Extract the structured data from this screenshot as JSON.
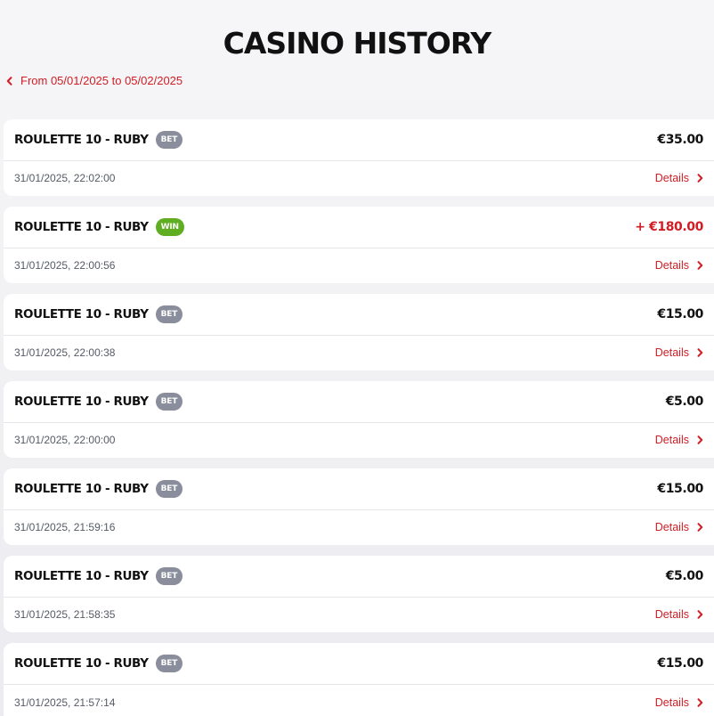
{
  "page": {
    "title": "CASINO HISTORY",
    "date_range_label": "From 05/01/2025 to 05/02/2025"
  },
  "colors": {
    "accent": "#d01e24",
    "bet_badge": "#8a8d9c",
    "win_badge": "#5fae22",
    "card_bg": "#ffffff",
    "page_bg": "#f1f1f4"
  },
  "icons": {
    "back": "chevron-left-icon",
    "details": "chevron-right-icon"
  },
  "transactions": [
    {
      "game": "ROULETTE 10 - RUBY",
      "type": "BET",
      "amount": "€35.00",
      "timestamp": "31/01/2025, 22:02:00",
      "details_label": "Details"
    },
    {
      "game": "ROULETTE 10 - RUBY",
      "type": "WIN",
      "amount": "+ €180.00",
      "timestamp": "31/01/2025, 22:00:56",
      "details_label": "Details"
    },
    {
      "game": "ROULETTE 10 - RUBY",
      "type": "BET",
      "amount": "€15.00",
      "timestamp": "31/01/2025, 22:00:38",
      "details_label": "Details"
    },
    {
      "game": "ROULETTE 10 - RUBY",
      "type": "BET",
      "amount": "€5.00",
      "timestamp": "31/01/2025, 22:00:00",
      "details_label": "Details"
    },
    {
      "game": "ROULETTE 10 - RUBY",
      "type": "BET",
      "amount": "€15.00",
      "timestamp": "31/01/2025, 21:59:16",
      "details_label": "Details"
    },
    {
      "game": "ROULETTE 10 - RUBY",
      "type": "BET",
      "amount": "€5.00",
      "timestamp": "31/01/2025, 21:58:35",
      "details_label": "Details"
    },
    {
      "game": "ROULETTE 10 - RUBY",
      "type": "BET",
      "amount": "€15.00",
      "timestamp": "31/01/2025, 21:57:14",
      "details_label": "Details"
    }
  ]
}
